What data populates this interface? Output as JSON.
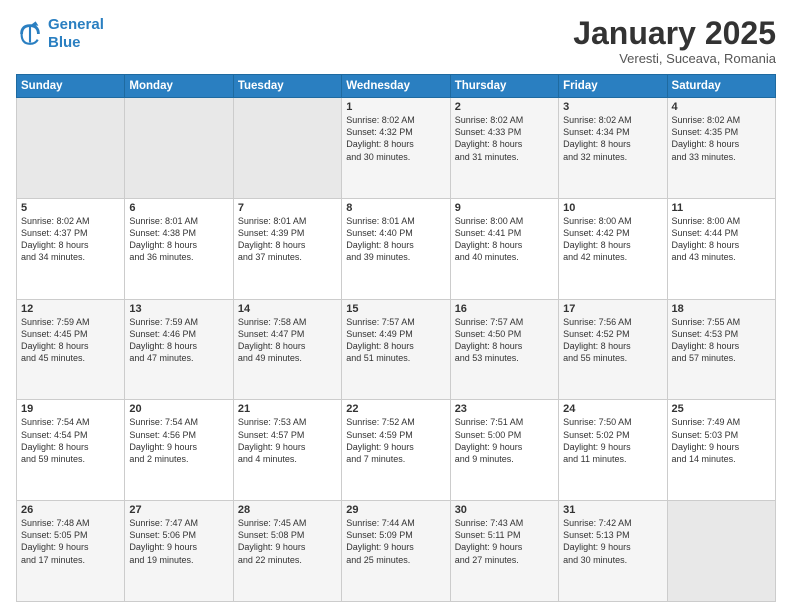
{
  "logo": {
    "line1": "General",
    "line2": "Blue"
  },
  "header": {
    "month": "January 2025",
    "location": "Veresti, Suceava, Romania"
  },
  "weekdays": [
    "Sunday",
    "Monday",
    "Tuesday",
    "Wednesday",
    "Thursday",
    "Friday",
    "Saturday"
  ],
  "weeks": [
    [
      {
        "day": "",
        "content": ""
      },
      {
        "day": "",
        "content": ""
      },
      {
        "day": "",
        "content": ""
      },
      {
        "day": "1",
        "content": "Sunrise: 8:02 AM\nSunset: 4:32 PM\nDaylight: 8 hours\nand 30 minutes."
      },
      {
        "day": "2",
        "content": "Sunrise: 8:02 AM\nSunset: 4:33 PM\nDaylight: 8 hours\nand 31 minutes."
      },
      {
        "day": "3",
        "content": "Sunrise: 8:02 AM\nSunset: 4:34 PM\nDaylight: 8 hours\nand 32 minutes."
      },
      {
        "day": "4",
        "content": "Sunrise: 8:02 AM\nSunset: 4:35 PM\nDaylight: 8 hours\nand 33 minutes."
      }
    ],
    [
      {
        "day": "5",
        "content": "Sunrise: 8:02 AM\nSunset: 4:37 PM\nDaylight: 8 hours\nand 34 minutes."
      },
      {
        "day": "6",
        "content": "Sunrise: 8:01 AM\nSunset: 4:38 PM\nDaylight: 8 hours\nand 36 minutes."
      },
      {
        "day": "7",
        "content": "Sunrise: 8:01 AM\nSunset: 4:39 PM\nDaylight: 8 hours\nand 37 minutes."
      },
      {
        "day": "8",
        "content": "Sunrise: 8:01 AM\nSunset: 4:40 PM\nDaylight: 8 hours\nand 39 minutes."
      },
      {
        "day": "9",
        "content": "Sunrise: 8:00 AM\nSunset: 4:41 PM\nDaylight: 8 hours\nand 40 minutes."
      },
      {
        "day": "10",
        "content": "Sunrise: 8:00 AM\nSunset: 4:42 PM\nDaylight: 8 hours\nand 42 minutes."
      },
      {
        "day": "11",
        "content": "Sunrise: 8:00 AM\nSunset: 4:44 PM\nDaylight: 8 hours\nand 43 minutes."
      }
    ],
    [
      {
        "day": "12",
        "content": "Sunrise: 7:59 AM\nSunset: 4:45 PM\nDaylight: 8 hours\nand 45 minutes."
      },
      {
        "day": "13",
        "content": "Sunrise: 7:59 AM\nSunset: 4:46 PM\nDaylight: 8 hours\nand 47 minutes."
      },
      {
        "day": "14",
        "content": "Sunrise: 7:58 AM\nSunset: 4:47 PM\nDaylight: 8 hours\nand 49 minutes."
      },
      {
        "day": "15",
        "content": "Sunrise: 7:57 AM\nSunset: 4:49 PM\nDaylight: 8 hours\nand 51 minutes."
      },
      {
        "day": "16",
        "content": "Sunrise: 7:57 AM\nSunset: 4:50 PM\nDaylight: 8 hours\nand 53 minutes."
      },
      {
        "day": "17",
        "content": "Sunrise: 7:56 AM\nSunset: 4:52 PM\nDaylight: 8 hours\nand 55 minutes."
      },
      {
        "day": "18",
        "content": "Sunrise: 7:55 AM\nSunset: 4:53 PM\nDaylight: 8 hours\nand 57 minutes."
      }
    ],
    [
      {
        "day": "19",
        "content": "Sunrise: 7:54 AM\nSunset: 4:54 PM\nDaylight: 8 hours\nand 59 minutes."
      },
      {
        "day": "20",
        "content": "Sunrise: 7:54 AM\nSunset: 4:56 PM\nDaylight: 9 hours\nand 2 minutes."
      },
      {
        "day": "21",
        "content": "Sunrise: 7:53 AM\nSunset: 4:57 PM\nDaylight: 9 hours\nand 4 minutes."
      },
      {
        "day": "22",
        "content": "Sunrise: 7:52 AM\nSunset: 4:59 PM\nDaylight: 9 hours\nand 7 minutes."
      },
      {
        "day": "23",
        "content": "Sunrise: 7:51 AM\nSunset: 5:00 PM\nDaylight: 9 hours\nand 9 minutes."
      },
      {
        "day": "24",
        "content": "Sunrise: 7:50 AM\nSunset: 5:02 PM\nDaylight: 9 hours\nand 11 minutes."
      },
      {
        "day": "25",
        "content": "Sunrise: 7:49 AM\nSunset: 5:03 PM\nDaylight: 9 hours\nand 14 minutes."
      }
    ],
    [
      {
        "day": "26",
        "content": "Sunrise: 7:48 AM\nSunset: 5:05 PM\nDaylight: 9 hours\nand 17 minutes."
      },
      {
        "day": "27",
        "content": "Sunrise: 7:47 AM\nSunset: 5:06 PM\nDaylight: 9 hours\nand 19 minutes."
      },
      {
        "day": "28",
        "content": "Sunrise: 7:45 AM\nSunset: 5:08 PM\nDaylight: 9 hours\nand 22 minutes."
      },
      {
        "day": "29",
        "content": "Sunrise: 7:44 AM\nSunset: 5:09 PM\nDaylight: 9 hours\nand 25 minutes."
      },
      {
        "day": "30",
        "content": "Sunrise: 7:43 AM\nSunset: 5:11 PM\nDaylight: 9 hours\nand 27 minutes."
      },
      {
        "day": "31",
        "content": "Sunrise: 7:42 AM\nSunset: 5:13 PM\nDaylight: 9 hours\nand 30 minutes."
      },
      {
        "day": "",
        "content": ""
      }
    ]
  ]
}
